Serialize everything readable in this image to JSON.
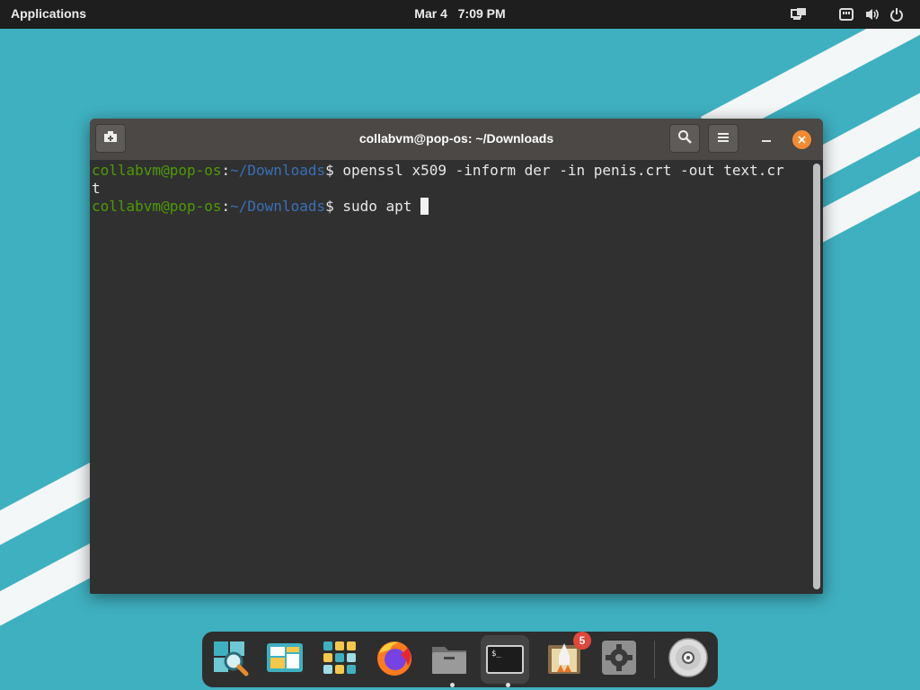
{
  "topbar": {
    "applications_label": "Applications",
    "date": "Mar 4",
    "time": "7:09 PM"
  },
  "terminal": {
    "title": "collabvm@pop-os: ~/Downloads",
    "lines": [
      {
        "user": "collabvm@pop-os",
        "sep": ":",
        "path": "~/Downloads",
        "prompt": "$ ",
        "command": "openssl x509 -inform der -in penis.crt -out text.cr",
        "wrap": "t"
      },
      {
        "user": "collabvm@pop-os",
        "sep": ":",
        "path": "~/Downloads",
        "prompt": "$ ",
        "command": "sudo apt "
      }
    ]
  },
  "dock": {
    "items": [
      {
        "name": "Search",
        "icon": "search-icon"
      },
      {
        "name": "Workspaces",
        "icon": "workspaces-icon"
      },
      {
        "name": "Applications",
        "icon": "app-grid-icon"
      },
      {
        "name": "Firefox",
        "icon": "firefox-icon"
      },
      {
        "name": "Files",
        "icon": "files-icon"
      },
      {
        "name": "Terminal",
        "icon": "terminal-icon"
      },
      {
        "name": "Pop!_Shop",
        "icon": "pop-shop-icon"
      },
      {
        "name": "Settings",
        "icon": "settings-icon"
      },
      {
        "name": "Disc",
        "icon": "disc-icon"
      }
    ],
    "terminal_icon_text": "$_",
    "shop_badge": "5"
  },
  "colors": {
    "desktop": "#3fb0c0",
    "close_button": "#f28a33",
    "prompt_user": "#4e9a06",
    "prompt_path": "#3a6fb8"
  }
}
